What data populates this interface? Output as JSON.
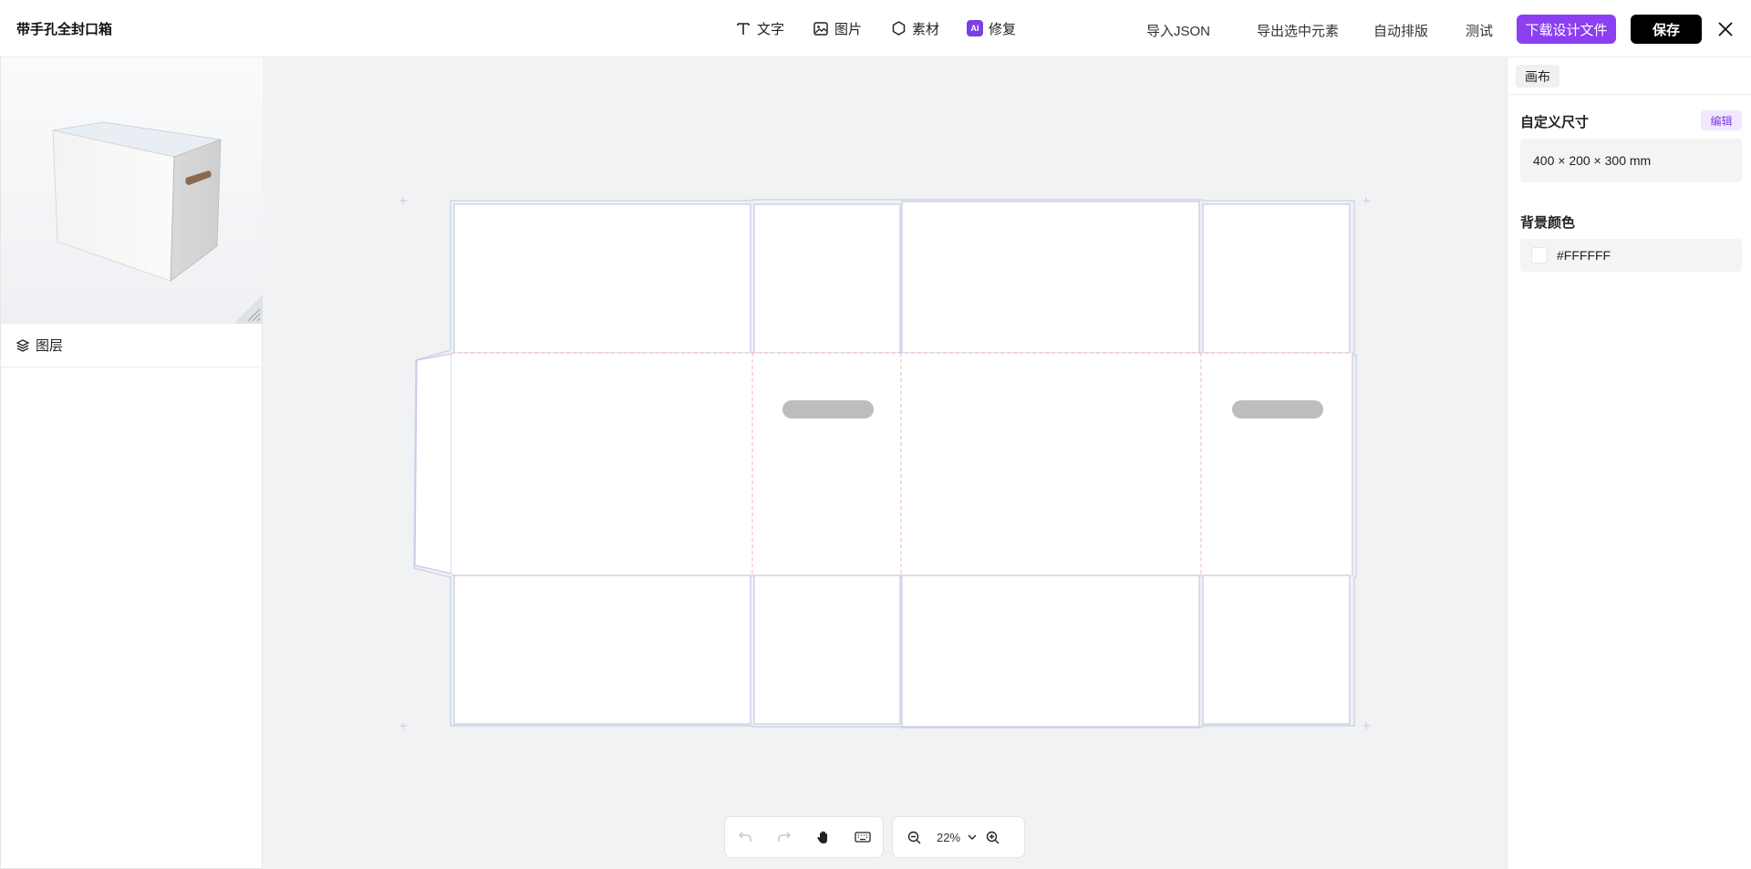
{
  "header": {
    "title": "带手孔全封口箱",
    "tools": [
      {
        "label": "文字",
        "icon": "text-icon"
      },
      {
        "label": "图片",
        "icon": "image-icon"
      },
      {
        "label": "素材",
        "icon": "hexagon-icon"
      },
      {
        "label": "修复",
        "icon": "ai-icon",
        "badge": "AI"
      }
    ],
    "actions": {
      "import_json": "导入JSON",
      "export_selected": "导出选中元素",
      "auto_layout": "自动排版",
      "test": "测试",
      "download": "下载设计文件",
      "save": "保存"
    },
    "colors": {
      "download_bg": "#8b3ff0",
      "save_bg": "#000000",
      "ai_badge": "#7b3fe4"
    }
  },
  "left_panel": {
    "preview_icon": "box-3d-preview",
    "layers_title": "图层"
  },
  "canvas": {
    "background": "#f1f2f4",
    "zoom": "22%"
  },
  "right_panel": {
    "tab": "画布",
    "size_label": "自定义尺寸",
    "edit_label": "编辑",
    "size_value": "400 × 200 × 300 mm",
    "bg_color_label": "背景颜色",
    "bg_color_value": "#FFFFFF"
  }
}
